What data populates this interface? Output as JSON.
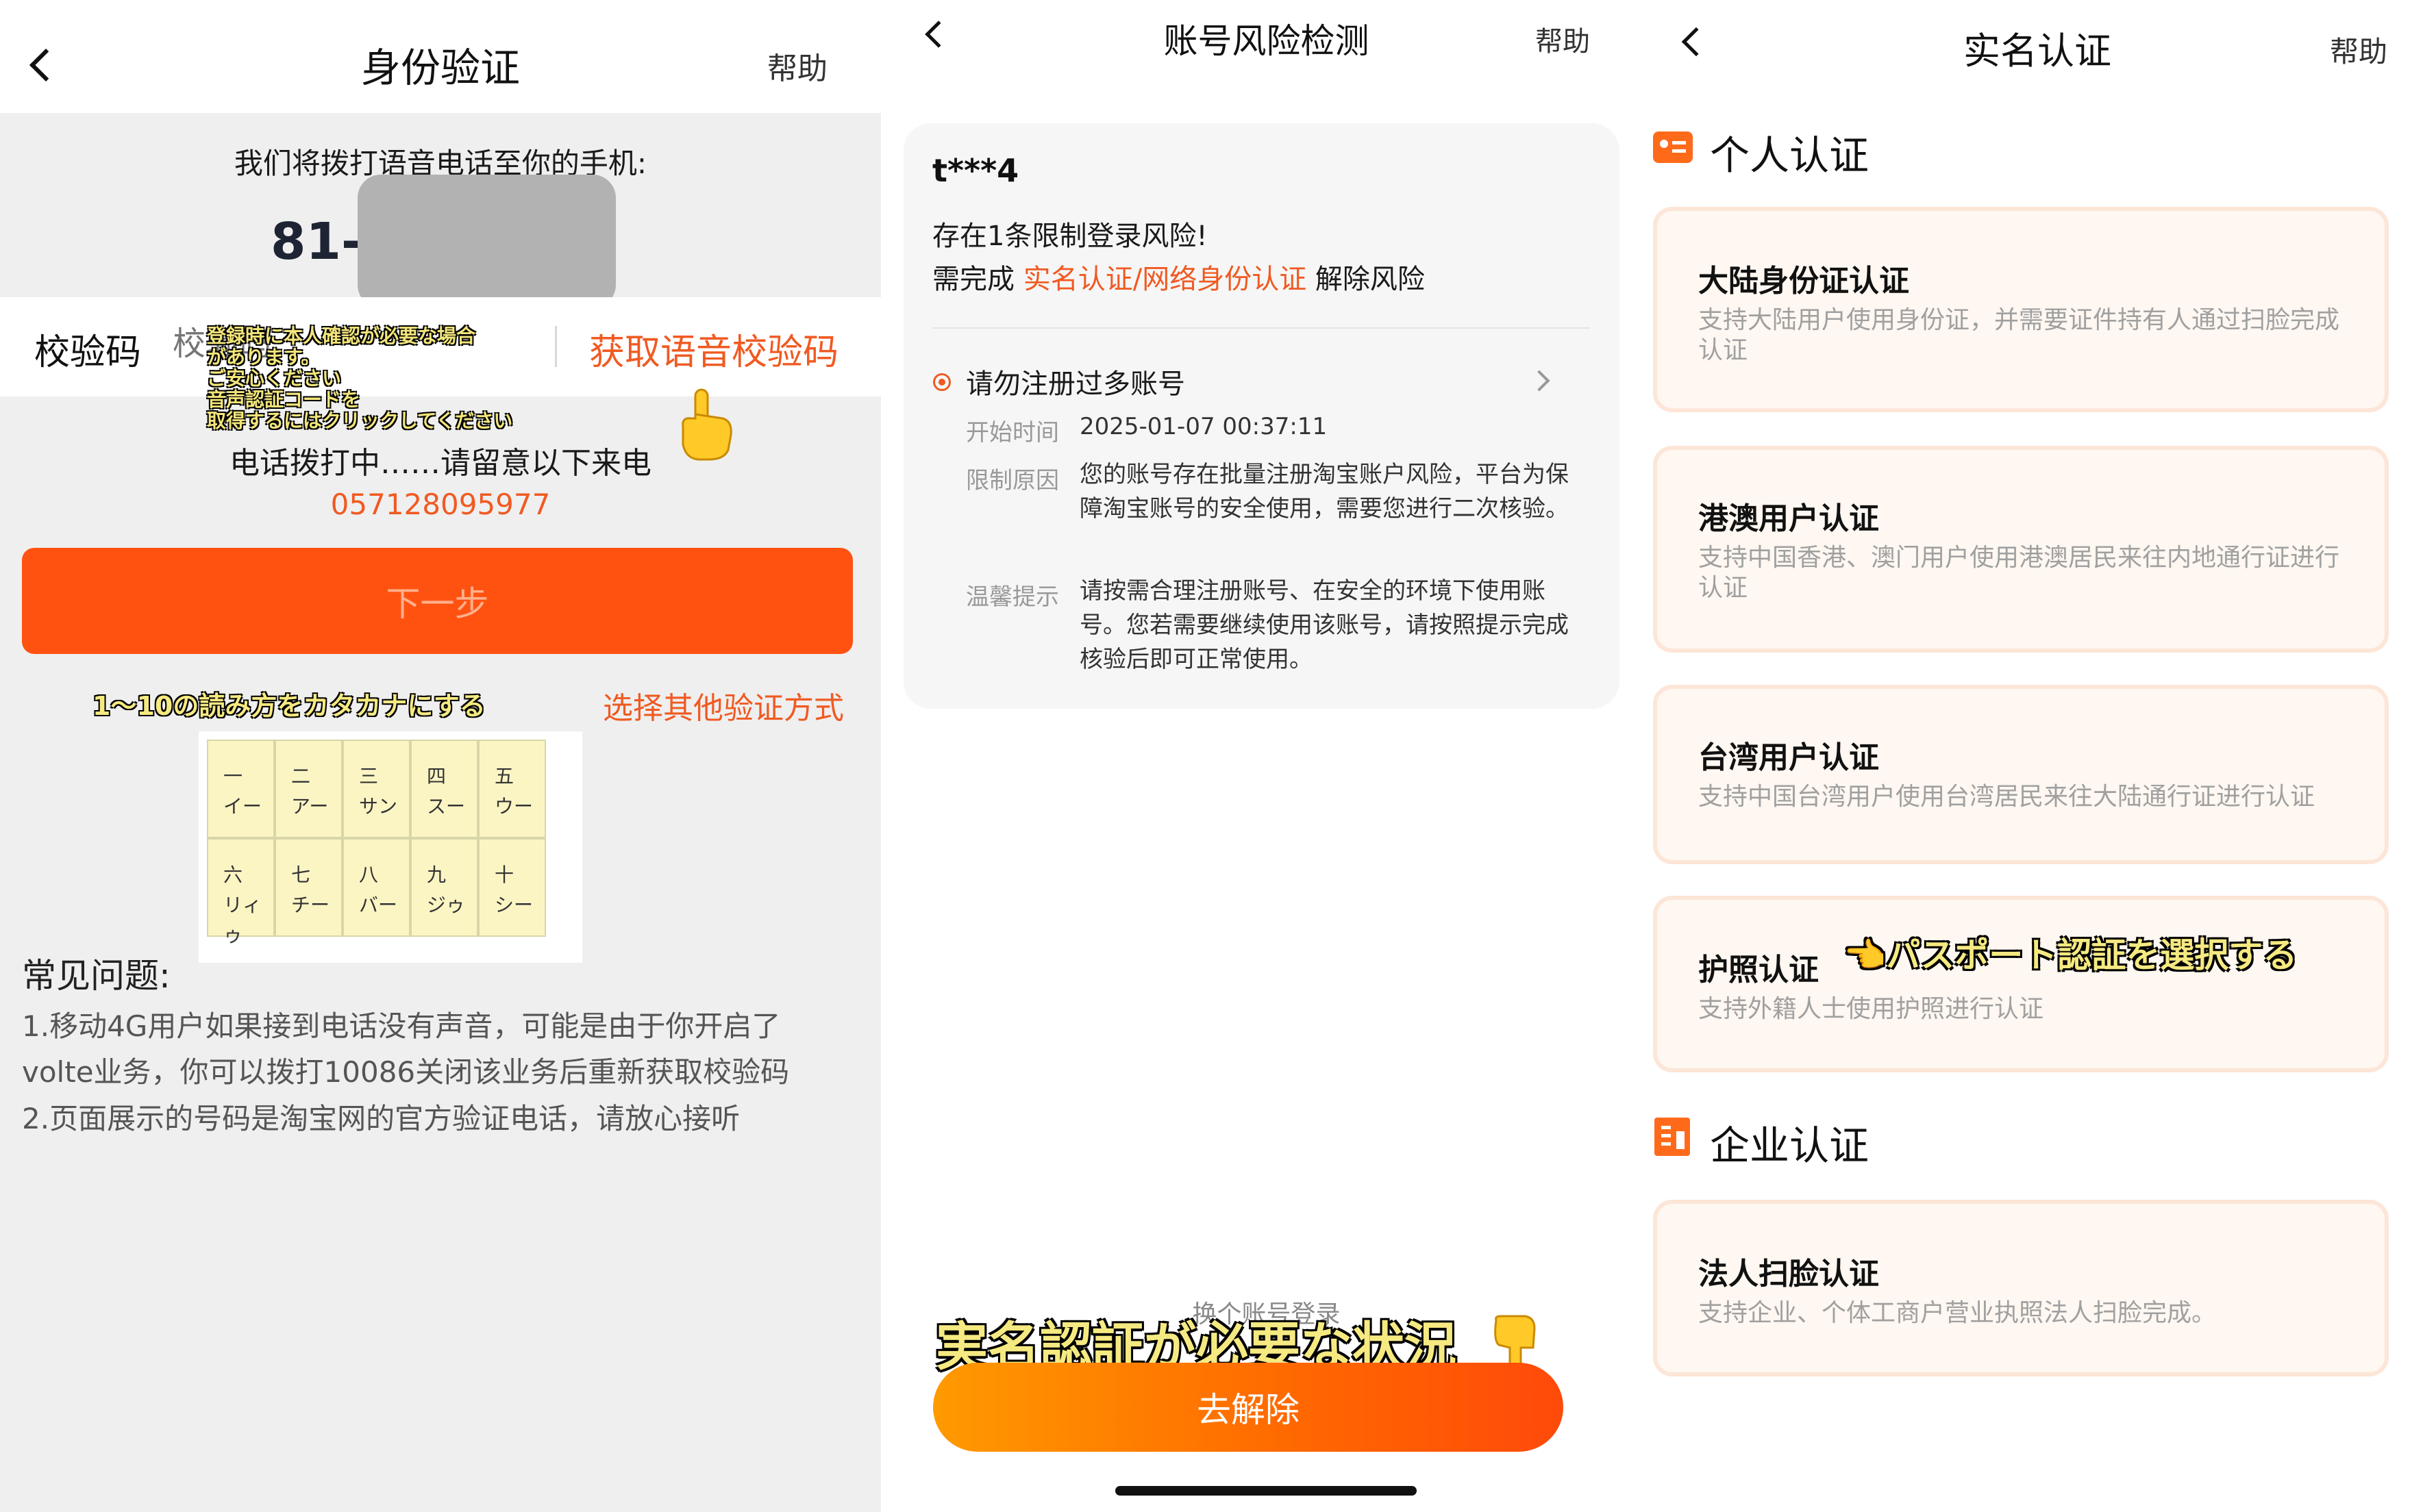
{
  "phone_verify": {
    "title": "身份验证",
    "help": "帮助",
    "prompt": "我们将拨打语音电话至你的手机:",
    "phone_prefix": "81-7",
    "code_label": "校验码",
    "code_placeholder": "校验码",
    "get_code": "获取语音校验码",
    "overlay_note": [
      "登録時に本人確認が必要な場合",
      "があります。",
      "ご安心ください",
      "音声認証コードを",
      "取得するにはクリックしてください"
    ],
    "calling": "电话拨打中……请留意以下来电",
    "caller_number": "057128095977",
    "next_button": "下一步",
    "yellow_caption": "1〜10の読み方をカタカナにする",
    "other_methods": "选择其他验证方式",
    "kana": [
      {
        "num": "一",
        "reading": "イー"
      },
      {
        "num": "二",
        "reading": "アー"
      },
      {
        "num": "三",
        "reading": "サン"
      },
      {
        "num": "四",
        "reading": "スー"
      },
      {
        "num": "五",
        "reading": "ウー"
      },
      {
        "num": "六",
        "reading": "リィゥ"
      },
      {
        "num": "七",
        "reading": "チー"
      },
      {
        "num": "八",
        "reading": "バー"
      },
      {
        "num": "九",
        "reading": "ジゥ"
      },
      {
        "num": "十",
        "reading": "シー"
      }
    ],
    "faq_title": "常见问题:",
    "faq_lines": [
      "1.移动4G用户如果接到电话没有声音，可能是由于你开启了",
      "volte业务，你可以拨打10086关闭该业务后重新获取校验码",
      "2.页面展示的号码是淘宝网的官方验证电话，请放心接听"
    ]
  },
  "risk_check": {
    "title": "账号风险检测",
    "help": "帮助",
    "account": "t***4",
    "risk_line": "存在1条限制登录风险!",
    "require_prefix": "需完成 ",
    "require_link": "实名认证/网络身份认证",
    "require_suffix": " 解除风险",
    "item_title": "请勿注册过多账号",
    "start_label": "开始时间",
    "start_value": "2025-01-07 00:37:11",
    "reason_label": "限制原因",
    "reason_value": "您的账号存在批量注册淘宝账户风险，平台为保障淘宝账号的安全使用，需要您进行二次核验。",
    "tip_label": "温馨提示",
    "tip_value": "请按需合理注册账号、在安全的环境下使用账号。您若需要继续使用该账号，请按照提示完成核验后即可正常使用。",
    "switch_account": "换个账号登录",
    "caption": "実名認証が必要な状況",
    "resolve_button": "去解除"
  },
  "realname": {
    "title": "实名认证",
    "help": "帮助",
    "personal_section": "个人认证",
    "enterprise_section": "企业认证",
    "cards": [
      {
        "title": "大陆身份证认证",
        "desc": "支持大陆用户使用身份证，并需要证件持有人通过扫脸完成认证"
      },
      {
        "title": "港澳用户认证",
        "desc": "支持中国香港、澳门用户使用港澳居民来往内地通行证进行认证"
      },
      {
        "title": "台湾用户认证",
        "desc": "支持中国台湾用户使用台湾居民来往大陆通行证进行认证"
      },
      {
        "title": "护照认证",
        "desc": "支持外籍人士使用护照进行认证"
      }
    ],
    "passport_note": "👈パスポート認証を選択する",
    "enterprise_card": {
      "title": "法人扫脸认证",
      "desc": "支持企业、个体工商户营业执照法人扫脸完成。"
    }
  },
  "colors": {
    "accent": "#f05a22",
    "button_orange": "#ff5211",
    "card_bg": "#fff7f1",
    "caption_yellow": "#f5e981"
  },
  "icons": [
    "back-chevron-icon",
    "pointing-hand-icon",
    "id-card-icon",
    "building-icon",
    "chevron-right-icon",
    "radio-dot-icon"
  ]
}
